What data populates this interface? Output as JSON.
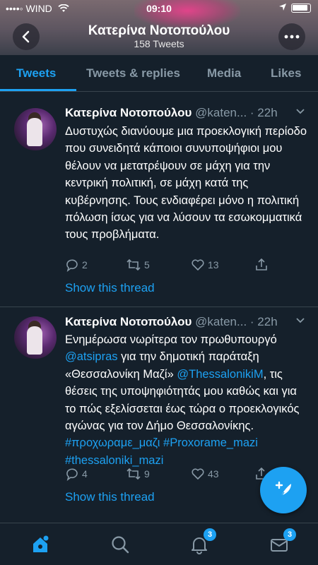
{
  "status_bar": {
    "carrier": "WIND",
    "time": "09:10"
  },
  "header": {
    "title": "Κατερίνα Νοτοπούλου",
    "tweet_count": "158 Tweets"
  },
  "tabs": [
    {
      "label": "Tweets",
      "active": true
    },
    {
      "label": "Tweets & replies",
      "active": false
    },
    {
      "label": "Media",
      "active": false
    },
    {
      "label": "Likes",
      "active": false
    }
  ],
  "tweets": [
    {
      "name": "Κατερίνα Νοτοπούλου",
      "handle": "@katen...",
      "time": "· 22h",
      "text": "Δυστυχώς διανύουμε μια προεκλογική περίοδο που συνειδητά κάποιοι συνυποψήφιοι μου θέλουν να μετατρέψουν σε μάχη για την κεντρική πολιτική, σε μάχη κατά της κυβέρνησης. Τους ενδιαφέρει μόνο η πολιτική πόλωση ίσως για να λύσουν τα εσωκομματικά τους προβλήματα.",
      "replies": "2",
      "retweets": "5",
      "likes": "13",
      "thread_link": "Show this thread"
    },
    {
      "name": "Κατερίνα Νοτοπούλου",
      "handle": "@katen...",
      "time": "· 22h",
      "text_parts": [
        "Ενημέρωσα νωρίτερα τον πρωθυπουργό ",
        "@atsipras",
        " για την δημοτική παράταξη «Θεσσαλονίκη Μαζί» ",
        "@ThessalonikiM",
        ", τις θέσεις της υποψηφιότητάς μου καθώς και για το πώς εξελίσσεται έως τώρα ο προεκλογικός αγώνας για τον Δήμο Θεσσαλονίκης. ",
        "#προχωραμε_μαζι",
        " ",
        "#Proxorame_mazi",
        " ",
        "#thessaloniki_mazi"
      ],
      "replies": "4",
      "retweets": "9",
      "likes": "43",
      "thread_link": "Show this thread"
    }
  ],
  "bottom_nav": {
    "home": {
      "icon": "home-icon"
    },
    "search": {
      "icon": "search-icon"
    },
    "notifications": {
      "icon": "bell-icon",
      "badge": "3"
    },
    "messages": {
      "icon": "mail-icon",
      "badge": "3"
    }
  },
  "colors": {
    "background": "#15202b",
    "accent": "#1da1f2",
    "muted": "#8899a6",
    "divider": "#38444d"
  }
}
